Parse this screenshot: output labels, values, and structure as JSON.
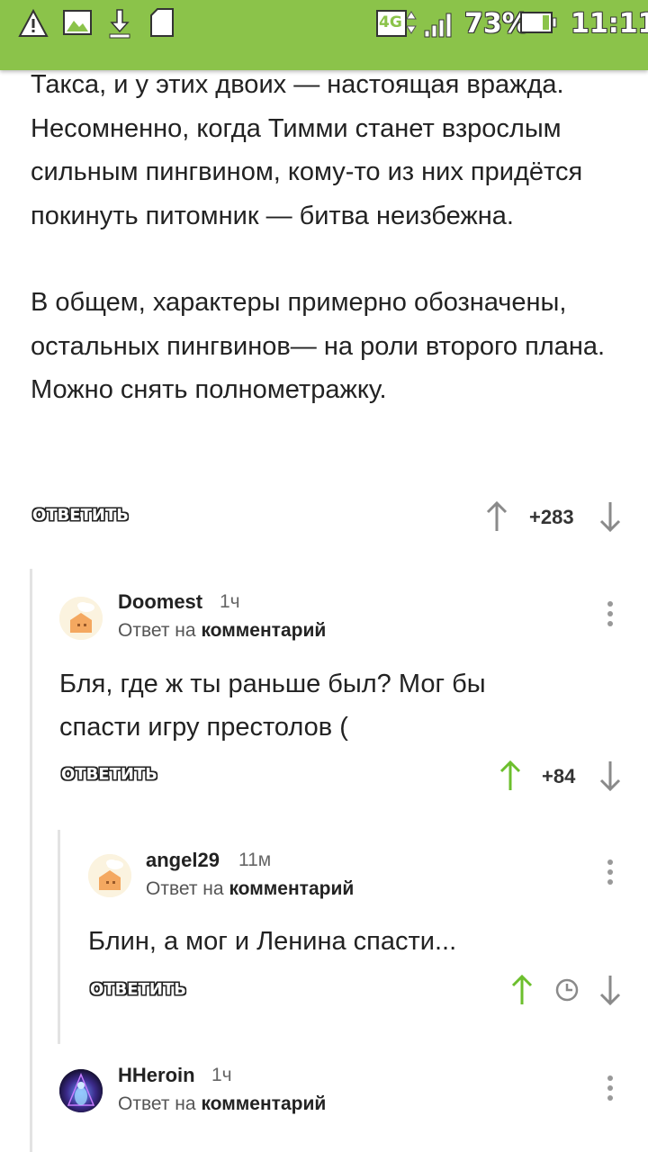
{
  "status_bar": {
    "network": "4G",
    "battery": "73%",
    "time": "11:11"
  },
  "post": {
    "paragraphs": [
      "Такса, и у этих двоих — настоящая вражда. Несомненно, когда Тимми станет взрослым сильным пингвином, кому-то из них придётся покинуть питомник — битва неизбежна.",
      "В общем, характеры примерно обозначены, остальных  пингвинов— на роли второго плана. Можно снять полнометражку."
    ],
    "reply_label": "ОТВЕТИТЬ",
    "rating": "+283"
  },
  "comments": [
    {
      "author": "Doomest",
      "time": "1ч",
      "reply_prefix": "Ответ на",
      "reply_target": "комментарий",
      "text": "Бля, где ж ты раньше был? Мог бы спасти игру престолов (",
      "reply_label": "ОТВЕТИТЬ",
      "rating": "+84"
    },
    {
      "author": "angel29",
      "time": "11м",
      "reply_prefix": "Ответ на",
      "reply_target": "комментарий",
      "text": "Блин, а мог и Ленина спасти...",
      "reply_label": "ОТВЕТИТЬ"
    },
    {
      "author": "HHeroin",
      "time": "1ч",
      "reply_prefix": "Ответ на",
      "reply_target": "комментарий"
    }
  ],
  "colors": {
    "status_bar": "#8bc34a",
    "upvote_active": "#6cbf2d",
    "arrow_gray": "#8a8a8a"
  }
}
